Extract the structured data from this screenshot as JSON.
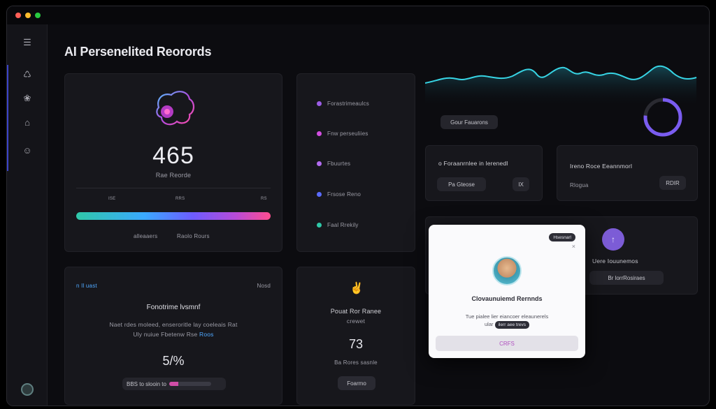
{
  "page": {
    "title": "AI Persenelited Reorords"
  },
  "sidebar": {
    "items": [
      {
        "icon": "menu-icon",
        "glyph": "☰"
      },
      {
        "icon": "chart-icon",
        "glyph": "♺"
      },
      {
        "icon": "brain-icon",
        "glyph": "❀"
      },
      {
        "icon": "lock-icon",
        "glyph": "⌂"
      },
      {
        "icon": "user-icon",
        "glyph": "☺"
      }
    ]
  },
  "score_card": {
    "value": "465",
    "label": "Rae Reorde",
    "axis": [
      "ISE",
      "RRS",
      "RS"
    ],
    "footer_left": "alleaaers",
    "footer_right": "Raolo Rours"
  },
  "legend": {
    "items": [
      {
        "label": "Forastrimeaulcs",
        "color": "#9b5de5"
      },
      {
        "label": "Fnw perseuliies",
        "color": "#d24ee0"
      },
      {
        "label": "Fbuurtes",
        "color": "#b26cf0"
      },
      {
        "label": "Frsose Reno",
        "color": "#5a6bff"
      },
      {
        "label": "Faal Rrekily",
        "color": "#2fc8a8"
      }
    ]
  },
  "wave_panel": {
    "pill": "Gour Fauarons"
  },
  "mini_cards": [
    {
      "title": "o Foraanrnlee in lerenedl",
      "tag": "Pa Gteose",
      "badge": "IX"
    },
    {
      "title": "Ireno Roce Eeannmorl",
      "tag": "Rlogua",
      "badge": "RDIR"
    }
  ],
  "mid_right_card": {
    "title": "Uere Iouunemos",
    "tag": "Br lorrRosiraes"
  },
  "bottom_left": {
    "header_left": "n Il uast",
    "header_right": "Nosd",
    "title": "Fonotrime lvsmnf",
    "desc_line1": "Naet rdes moleed, enseroritle lay coeleais Rat",
    "desc_line2": "Uly nuiue Fbetenw Rse",
    "desc_link": "Roos",
    "stat": "5/%",
    "bar_label": "BBS to slooin to",
    "bar_progress": 0.22
  },
  "bottom_mid": {
    "title_line1": "Pouat Ror Ranee",
    "title_line2": "crewet",
    "value": "73",
    "caption": "Ba Rores sasnle",
    "button": "Foarmo"
  },
  "modal": {
    "badge": "Hsesnarl",
    "close": "×",
    "title": "Clovaunuiemd Rernnds",
    "text_line1": "Tue pialee lier eiancoer eleaunerels",
    "text_line2": "ular",
    "text_tag": "ilerr aee trevs",
    "button": "CRFS"
  },
  "colors": {
    "accent": "#3b44c9",
    "wave": "#37d4e4",
    "ring_start": "#6d5cff",
    "ring_end": "#8a5cf0",
    "purple_badge": "#7c5cd6"
  }
}
